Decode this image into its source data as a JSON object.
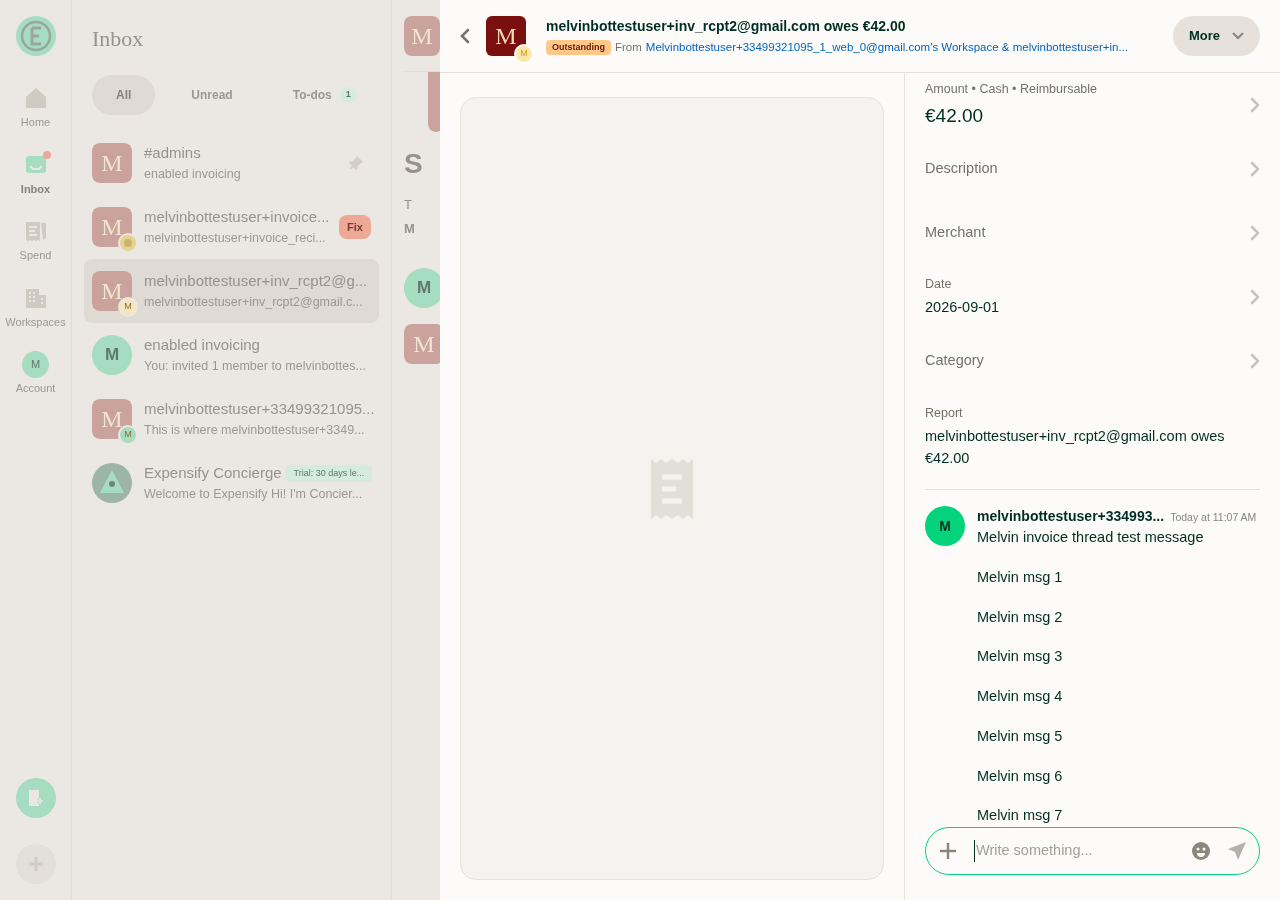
{
  "nav": {
    "items": [
      {
        "kind": "icon",
        "label": "Home",
        "selected": false,
        "dot": false
      },
      {
        "kind": "icon",
        "label": "Inbox",
        "selected": true,
        "dot": true
      },
      {
        "kind": "icon",
        "label": "Spend",
        "selected": false,
        "dot": false
      },
      {
        "kind": "icon",
        "label": "Workspaces",
        "selected": false,
        "dot": false
      },
      {
        "kind": "avatar",
        "label": "Account",
        "letter": "M",
        "selected": false,
        "dot": false
      }
    ]
  },
  "inbox": {
    "title": "Inbox",
    "tabs": [
      {
        "label": "All",
        "selected": true
      },
      {
        "label": "Unread",
        "selected": false
      },
      {
        "label": "To-dos",
        "count": "1",
        "selected": false
      }
    ],
    "chats": [
      {
        "avatar": {
          "kind": "square",
          "letter": "M"
        },
        "title": "#admins",
        "subtitle": "enabled invoicing",
        "selected": false,
        "pinned": true
      },
      {
        "avatar": {
          "kind": "square",
          "letter": "M"
        },
        "sub_avatar": {
          "kind": "image"
        },
        "title": "melvinbottestuser+invoice...",
        "subtitle": "melvinbottestuser+invoice_reci...",
        "selected": false,
        "pinned": false,
        "badge": {
          "kind": "fix",
          "text": "Fix"
        }
      },
      {
        "avatar": {
          "kind": "square",
          "letter": "M"
        },
        "sub_avatar": {
          "kind": "letter",
          "letter": "M",
          "color": "#f3e6c0"
        },
        "title": "melvinbottestuser+inv_rcpt2@g...",
        "subtitle": "melvinbottestuser+inv_rcpt2@gmail.c...",
        "selected": true,
        "pinned": false
      },
      {
        "avatar": {
          "kind": "round",
          "letter": "M"
        },
        "title": "enabled invoicing",
        "subtitle": "You: invited 1 member to melvinbottes...",
        "selected": false,
        "pinned": false
      },
      {
        "avatar": {
          "kind": "square",
          "letter": "M"
        },
        "sub_avatar": {
          "kind": "letter",
          "letter": "M",
          "color": "#a6dcc0"
        },
        "title": "melvinbottestuser+33499321095...",
        "subtitle": "This is where melvinbottestuser+3349...",
        "selected": false,
        "pinned": false
      },
      {
        "avatar": {
          "kind": "concierge"
        },
        "title": "Expensify Concierge",
        "subtitle": "Welcome to Expensify Hi! I'm Concier...",
        "selected": false,
        "pinned": false,
        "badge": {
          "kind": "trial",
          "text": "Trial: 30 days le..."
        }
      }
    ]
  },
  "chat_behind": {
    "header_avatar": "M",
    "heading": "S",
    "line_1": "T",
    "line_2": "M",
    "avatars": [
      {
        "kind": "round",
        "letter": "M"
      },
      {
        "kind": "square",
        "letter": "M"
      }
    ]
  },
  "expense": {
    "header": {
      "avatar": "M",
      "sub_avatar": "M",
      "title": "melvinbottestuser+inv_rcpt2@gmail.com owes €42.00",
      "status": "Outstanding",
      "from_label": "From",
      "from_link": "Melvinbottestuser+33499321095_1_web_0@gmail.com's Workspace & melvinbottestuser+in...",
      "more_button": "More"
    },
    "fields": [
      {
        "kind": "amount",
        "label": "Amount • Cash • Reimbursable",
        "value": "€42.00"
      },
      {
        "kind": "empty",
        "label": "Description"
      },
      {
        "kind": "empty",
        "label": "Merchant"
      },
      {
        "kind": "value",
        "label": "Date",
        "value": "2026-09-01"
      },
      {
        "kind": "empty",
        "label": "Category"
      },
      {
        "kind": "report",
        "label": "Report",
        "value": "melvinbottestuser+inv_rcpt2@gmail.com owes €42.00"
      }
    ],
    "message": {
      "avatar": "M",
      "author": "melvinbottestuser+334993...",
      "time": "Today at 11:07 AM",
      "lines": [
        "Melvin invoice thread test message",
        "Melvin msg 1",
        "Melvin msg 2",
        "Melvin msg 3",
        "Melvin msg 4",
        "Melvin msg 5",
        "Melvin msg 6",
        "Melvin msg 7"
      ]
    },
    "composer": {
      "placeholder": "Write something..."
    }
  }
}
